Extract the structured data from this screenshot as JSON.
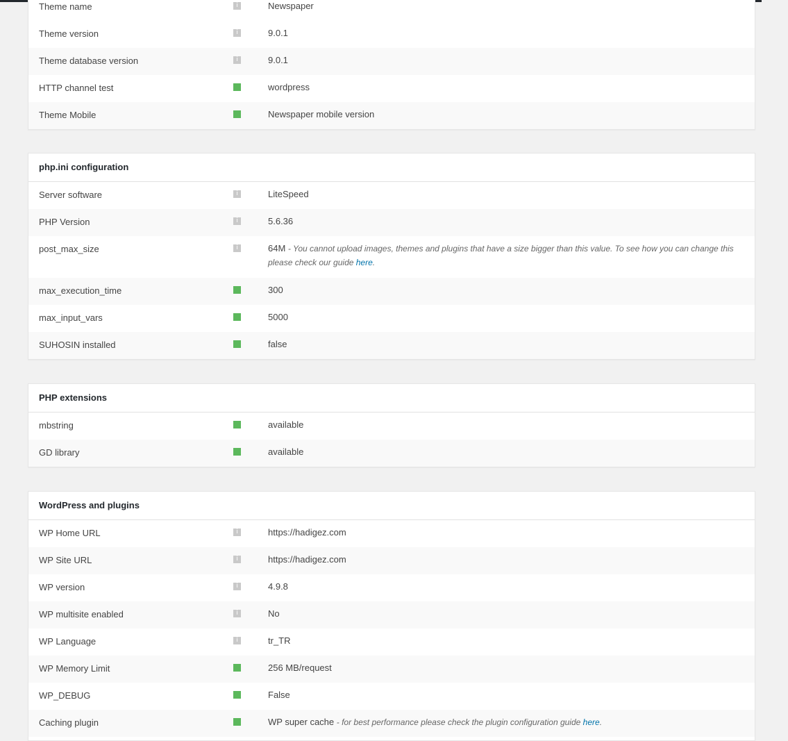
{
  "colors": {
    "ok": "#5cb85c",
    "info": "#c9c9c9",
    "link": "#0073aa"
  },
  "theme_panel": {
    "rows": [
      {
        "label": "Theme name",
        "status": "info",
        "value": "Newspaper"
      },
      {
        "label": "Theme version",
        "status": "info",
        "value": "9.0.1"
      },
      {
        "label": "Theme database version",
        "status": "info",
        "value": "9.0.1"
      },
      {
        "label": "HTTP channel test",
        "status": "ok",
        "value": "wordpress"
      },
      {
        "label": "Theme Mobile",
        "status": "ok",
        "value": "Newspaper mobile version"
      }
    ]
  },
  "php_ini_panel": {
    "title": "php.ini configuration",
    "rows": [
      {
        "label": "Server software",
        "status": "info",
        "value": "LiteSpeed"
      },
      {
        "label": "PHP Version",
        "status": "info",
        "value": "5.6.36"
      },
      {
        "label": "post_max_size",
        "status": "info",
        "value": "64M",
        "note": "- You cannot upload images, themes and plugins that have a size bigger than this value. To see how you can change this please check our guide ",
        "link": "here",
        "note_end": "."
      },
      {
        "label": "max_execution_time",
        "status": "ok",
        "value": "300"
      },
      {
        "label": "max_input_vars",
        "status": "ok",
        "value": "5000"
      },
      {
        "label": "SUHOSIN installed",
        "status": "ok",
        "value": "false"
      }
    ]
  },
  "php_ext_panel": {
    "title": "PHP extensions",
    "rows": [
      {
        "label": "mbstring",
        "status": "ok",
        "value": "available"
      },
      {
        "label": "GD library",
        "status": "ok",
        "value": "available"
      }
    ]
  },
  "wp_panel": {
    "title": "WordPress and plugins",
    "rows": [
      {
        "label": "WP Home URL",
        "status": "info",
        "value": "https://hadigez.com"
      },
      {
        "label": "WP Site URL",
        "status": "info",
        "value": "https://hadigez.com"
      },
      {
        "label": "WP version",
        "status": "info",
        "value": "4.9.8"
      },
      {
        "label": "WP multisite enabled",
        "status": "info",
        "value": "No"
      },
      {
        "label": "WP Language",
        "status": "info",
        "value": "tr_TR"
      },
      {
        "label": "WP Memory Limit",
        "status": "ok",
        "value": "256 MB/request"
      },
      {
        "label": "WP_DEBUG",
        "status": "ok",
        "value": "False"
      },
      {
        "label": "Caching plugin",
        "status": "ok",
        "value": "WP super cache",
        "note": "- for best performance please check the plugin configuration guide ",
        "link": "here",
        "note_end": "."
      }
    ]
  },
  "info_icon_glyph": "i"
}
